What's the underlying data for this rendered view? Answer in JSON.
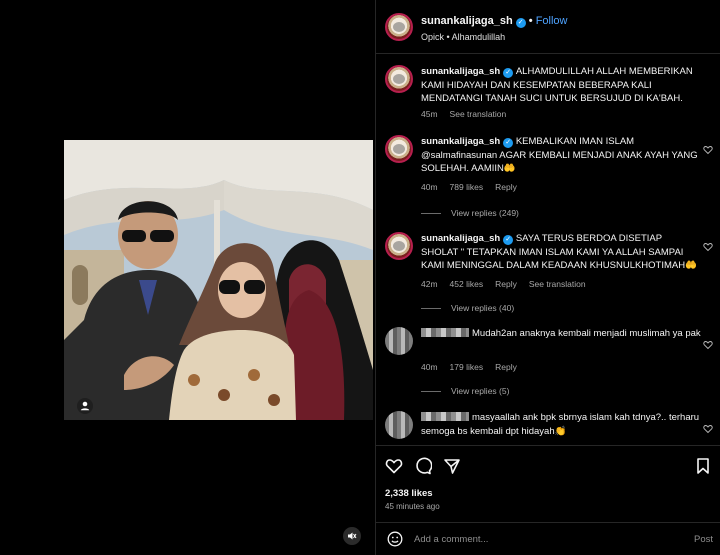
{
  "header": {
    "username": "sunankalijaga_sh",
    "verified_mark": "✓",
    "separator": " • ",
    "follow_label": "Follow",
    "audio": "Opick • Alhamdulillah"
  },
  "comments": [
    {
      "username": "sunankalijaga_sh",
      "text": "ALHAMDULILLAH ALLAH MEMBERIKAN KAMI HIDAYAH DAN KESEMPATAN BEBERAPA KALI MENDATANGI TANAH SUCI UNTUK BERSUJUD DI KA'BAH.",
      "time": "45m",
      "see_translation": "See translation"
    },
    {
      "username": "sunankalijaga_sh",
      "text": "KEMBALIKAN IMAN ISLAM @salmafinasunan AGAR KEMBALI MENJADI ANAK AYAH YANG SOLEHAH. AAMIIN🤲",
      "time": "40m",
      "likes": "789 likes",
      "reply": "Reply",
      "view_replies": "View replies (249)"
    },
    {
      "username": "sunankalijaga_sh",
      "text": "SAYA TERUS BERDOA DISETIAP SHOLAT \" TETAPKAN IMAN ISLAM KAMI YA ALLAH SAMPAI KAMI MENINGGAL DALAM KEADAAN KHUSNULKHOTIMAH🤲",
      "time": "42m",
      "likes": "452 likes",
      "reply": "Reply",
      "see_translation": "See translation",
      "view_replies": "View replies (40)"
    },
    {
      "text": "Mudah2an anaknya kembali menjadi muslimah ya pak",
      "time": "40m",
      "likes": "179 likes",
      "reply": "Reply",
      "view_replies": "View replies (5)"
    },
    {
      "text": "masyaallah ank bpk sbrnya islam kah tdnya?.. terharu semoga bs kembali dpt hidayah👏"
    }
  ],
  "stats": {
    "likes": "2,338 likes",
    "posted": "45 minutes ago"
  },
  "composer": {
    "placeholder": "Add a comment...",
    "post_label": "Post"
  },
  "icons": {
    "like": "heart-icon",
    "comment": "comment-icon",
    "share": "share-icon",
    "save": "bookmark-icon",
    "emoji": "emoji-icon",
    "tagged": "user-tag-icon",
    "mute": "mute-icon"
  },
  "colors": {
    "background": "#000000",
    "link": "#4ea3ff",
    "verified": "#1d9bf0",
    "muted_text": "#a8a8a8"
  }
}
